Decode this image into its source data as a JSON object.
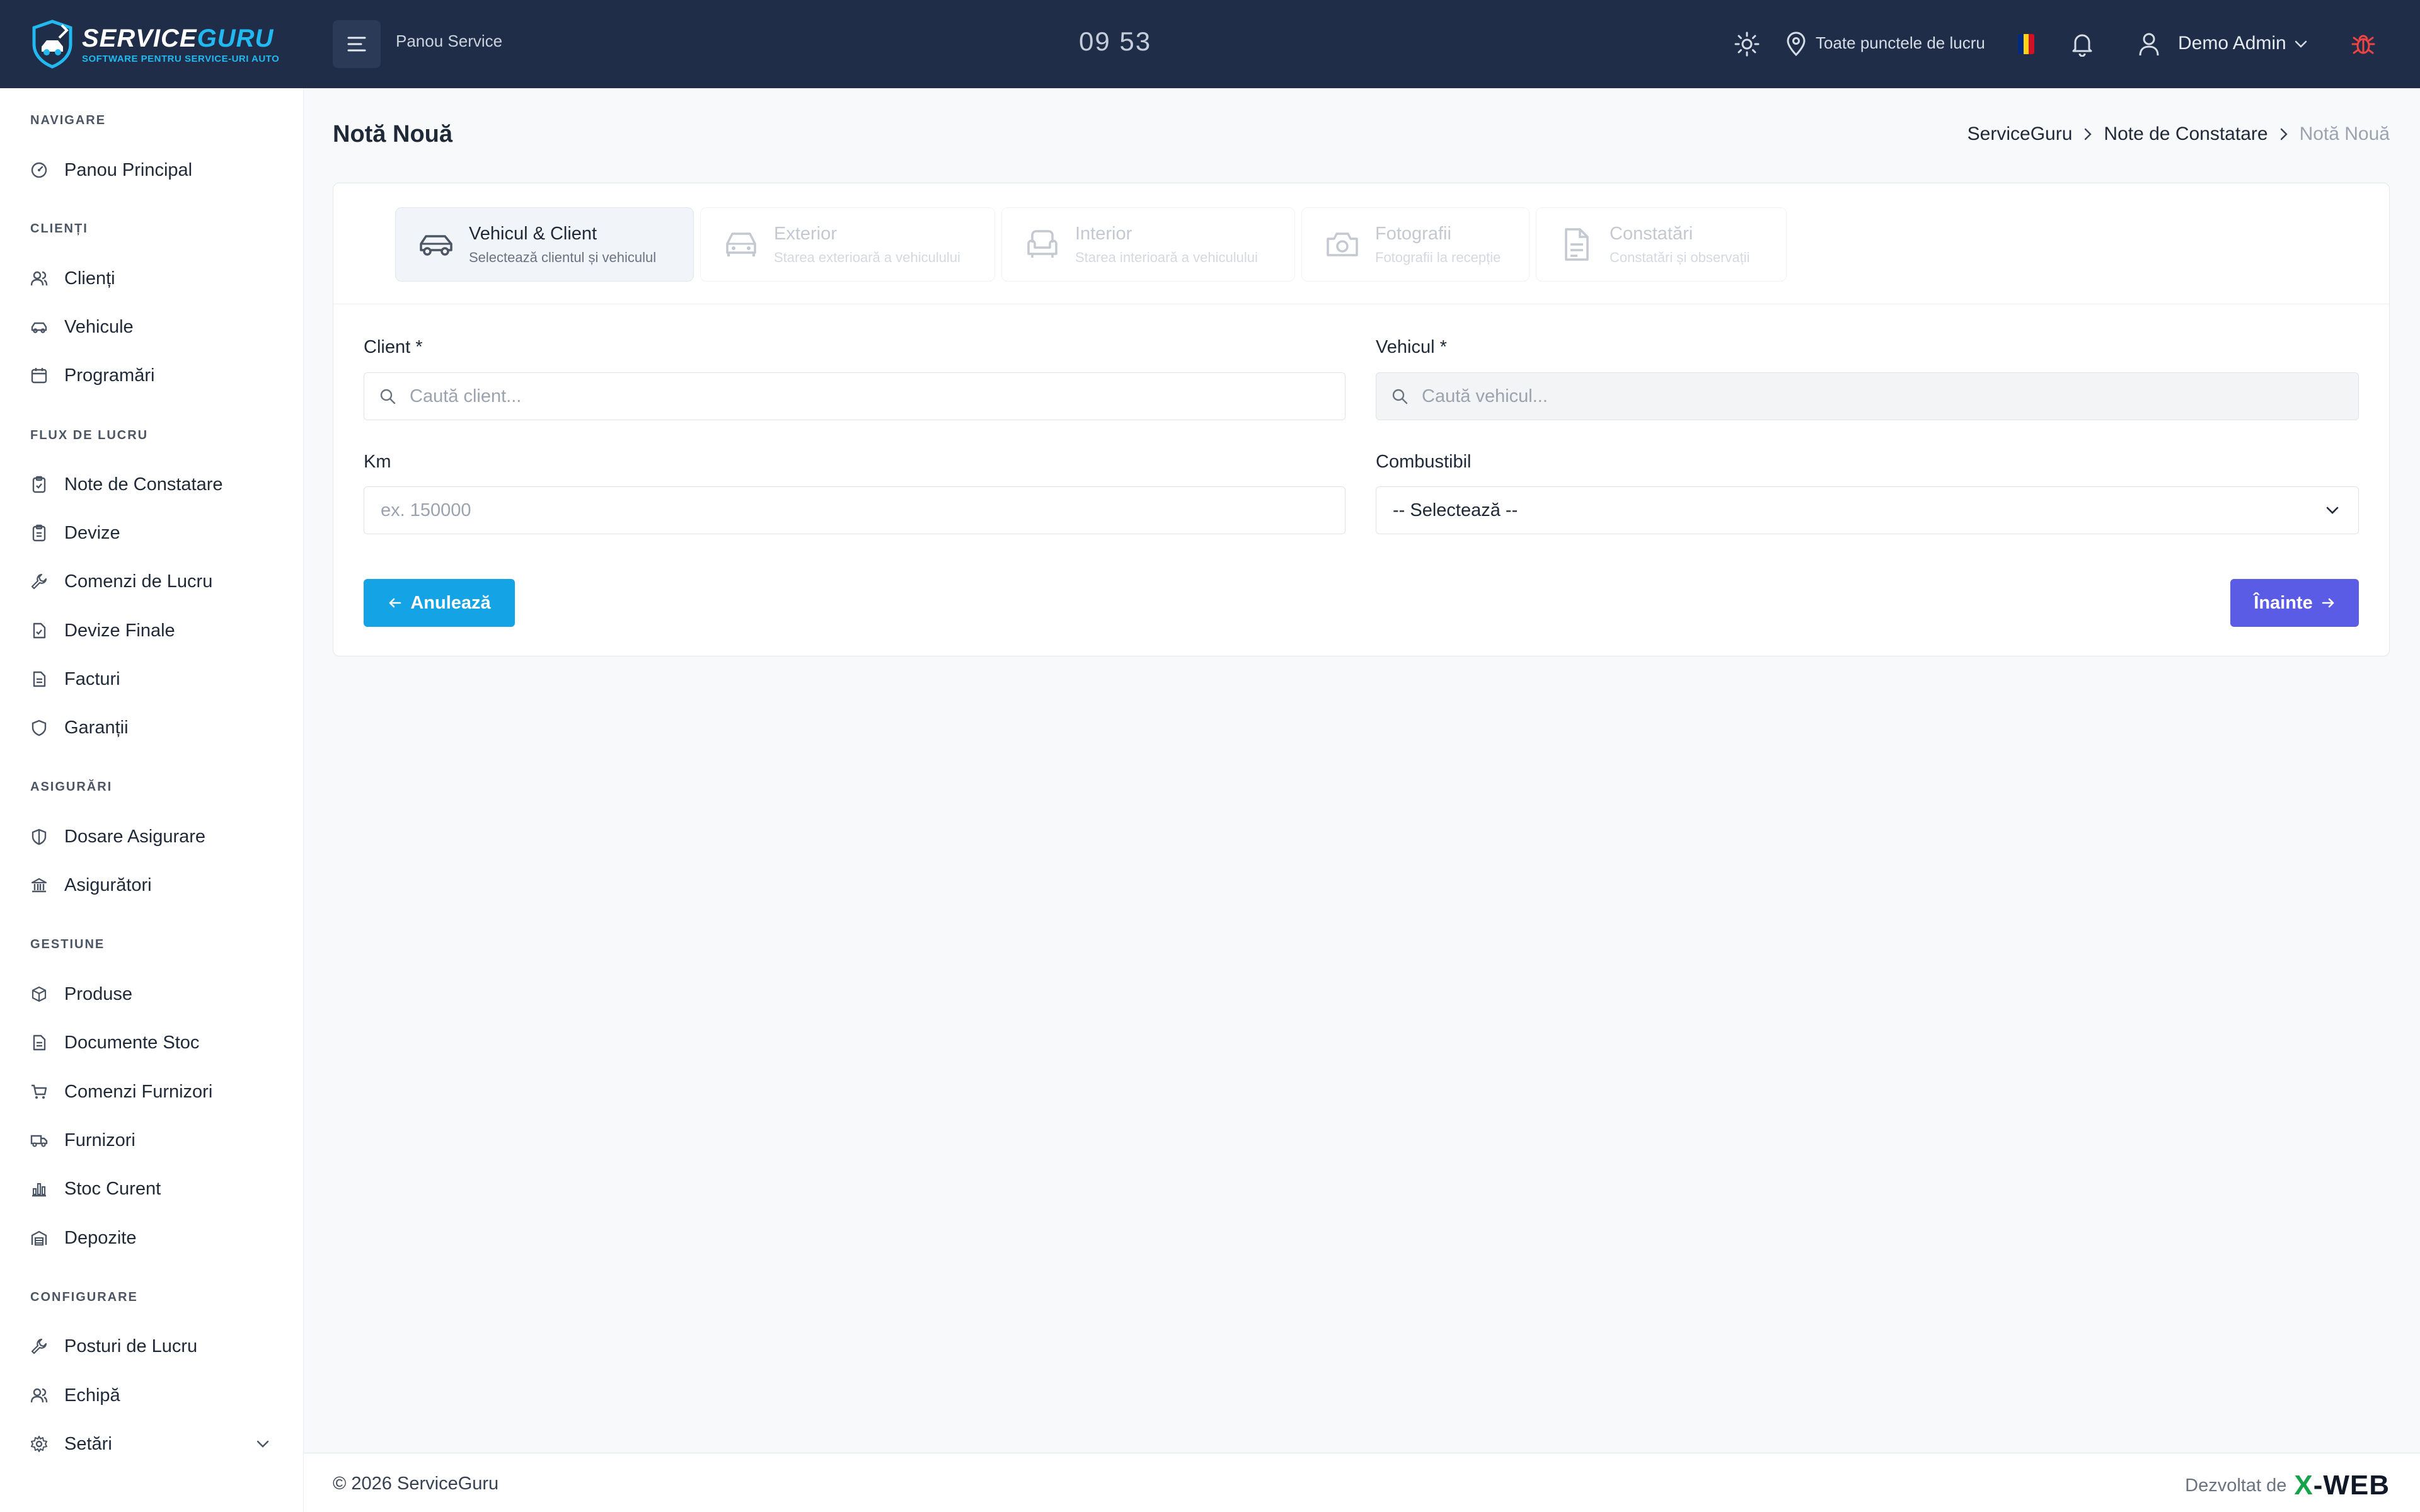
{
  "header": {
    "logo_title_a": "SERVICE",
    "logo_title_b": "GURU",
    "logo_subtitle": "SOFTWARE PENTRU SERVICE-URI AUTO",
    "panel_label": "Panou Service",
    "clock": "09 53",
    "location": "Toate punctele de lucru",
    "user_name": "Demo Admin",
    "flag_colors": [
      "#002b7f",
      "#fcd116",
      "#ce1126"
    ]
  },
  "sidebar": {
    "sections": {
      "navigare": "NAVIGARE",
      "clienti": "CLIENȚI",
      "flux": "FLUX DE LUCRU",
      "asigurari": "ASIGURĂRI",
      "gestiune": "GESTIUNE",
      "configurare": "CONFIGURARE"
    },
    "items": {
      "panou": "Panou Principal",
      "clienti": "Clienți",
      "vehicule": "Vehicule",
      "programari": "Programări",
      "note": "Note de Constatare",
      "devize": "Devize",
      "comenzi_lucru": "Comenzi de Lucru",
      "devize_finale": "Devize Finale",
      "facturi": "Facturi",
      "garantii": "Garanții",
      "dosare": "Dosare Asigurare",
      "asiguratori": "Asigurători",
      "produse": "Produse",
      "documente_stoc": "Documente Stoc",
      "comenzi_furnizori": "Comenzi Furnizori",
      "furnizori": "Furnizori",
      "stoc_curent": "Stoc Curent",
      "depozite": "Depozite",
      "posturi": "Posturi de Lucru",
      "echipa": "Echipă",
      "setari": "Setări"
    }
  },
  "main": {
    "title": "Notă Nouă",
    "breadcrumb": [
      "ServiceGuru",
      "Note de Constatare",
      "Notă Nouă"
    ],
    "steps": [
      {
        "title": "Vehicul & Client",
        "subtitle": "Selectează clientul și vehiculul"
      },
      {
        "title": "Exterior",
        "subtitle": "Starea exterioară a vehiculului"
      },
      {
        "title": "Interior",
        "subtitle": "Starea interioară a vehiculului"
      },
      {
        "title": "Fotografii",
        "subtitle": "Fotografii la recepție"
      },
      {
        "title": "Constatări",
        "subtitle": "Constatări și observații"
      }
    ],
    "form": {
      "client_label": "Client *",
      "client_placeholder": "Caută client...",
      "vehicul_label": "Vehicul *",
      "vehicul_placeholder": "Caută vehicul...",
      "km_label": "Km",
      "km_placeholder": "ex. 150000",
      "combustibil_label": "Combustibil",
      "combustibil_value": "-- Selectează --"
    },
    "buttons": {
      "cancel": "Anulează",
      "next": "Înainte"
    }
  },
  "footer": {
    "copyright": "© 2026 ServiceGuru",
    "developed_by": "Dezvoltat de",
    "brand_x": "X",
    "brand_rest": "-WEB"
  }
}
